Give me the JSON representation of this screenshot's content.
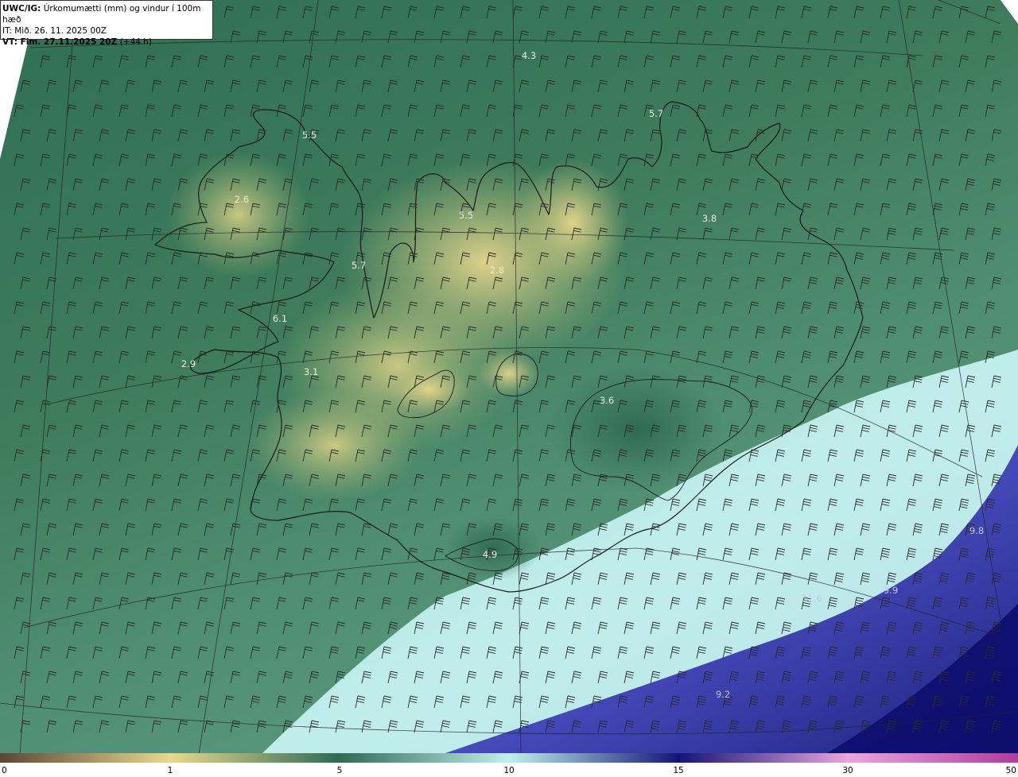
{
  "title": {
    "line1_bold": "UWC/IG:",
    "line1_rest": " Úrkomumætti (mm) og vindur í 100m hæð",
    "line2": "IT: Mið. 26. 11. 2025 00Z",
    "line3_bold": "VT: Fim. 27.11.2025 20Z",
    "line3_rest": " (+44 h)"
  },
  "map_labels": [
    {
      "id": "l1",
      "text": "4.3"
    },
    {
      "id": "l2",
      "text": "5.7"
    },
    {
      "id": "l3",
      "text": "5.5"
    },
    {
      "id": "l4",
      "text": "2.6"
    },
    {
      "id": "l5",
      "text": "5.5"
    },
    {
      "id": "l6",
      "text": "3.8"
    },
    {
      "id": "l7",
      "text": "5.7"
    },
    {
      "id": "l8",
      "text": "2.8"
    },
    {
      "id": "l9",
      "text": "6.1"
    },
    {
      "id": "l10",
      "text": "2.9"
    },
    {
      "id": "l11",
      "text": "3.1"
    },
    {
      "id": "l12",
      "text": "3.6"
    },
    {
      "id": "l13",
      "text": "4.9"
    },
    {
      "id": "l14",
      "text": "11.6"
    },
    {
      "id": "l15",
      "text": "9.8"
    },
    {
      "id": "l16",
      "text": "9.9"
    },
    {
      "id": "l17",
      "text": "9.2"
    }
  ],
  "colorbar": {
    "ticks": [
      "0",
      "1",
      "5",
      "10",
      "15",
      "30",
      "50"
    ],
    "colors": [
      "#5a4636",
      "#e8d98e",
      "#2e6a55",
      "#bff0ec",
      "#141478",
      "#e8a6dc",
      "#b03c9e"
    ]
  },
  "colors": {
    "land_label": "#f0f0dc",
    "sea_label": "#b8b8c8",
    "coast": "#1a1a1a",
    "grid": "#222222",
    "barb": "#2a2a2a"
  }
}
